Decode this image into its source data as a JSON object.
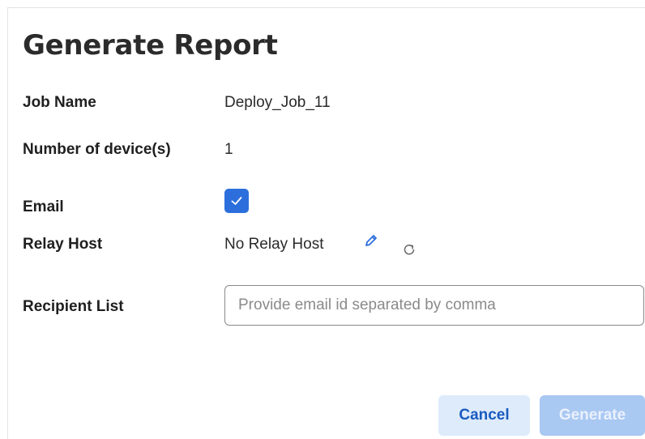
{
  "dialog": {
    "title": "Generate Report"
  },
  "fields": {
    "job_name": {
      "label": "Job Name",
      "value": "Deploy_Job_11"
    },
    "device_count": {
      "label": "Number of device(s)",
      "value": "1"
    },
    "email": {
      "label": "Email",
      "checked": true
    },
    "relay_host": {
      "label": "Relay Host",
      "value": "No Relay Host",
      "edit_icon": "pencil-icon",
      "refresh_icon": "refresh-icon"
    },
    "recipient_list": {
      "label": "Recipient List",
      "value": "",
      "placeholder": "Provide email id separated by comma"
    }
  },
  "actions": {
    "cancel_label": "Cancel",
    "generate_label": "Generate"
  },
  "colors": {
    "accent": "#2c6fdc",
    "cancel_bg": "#deebfb",
    "generate_disabled_bg": "#a9c8f2"
  }
}
